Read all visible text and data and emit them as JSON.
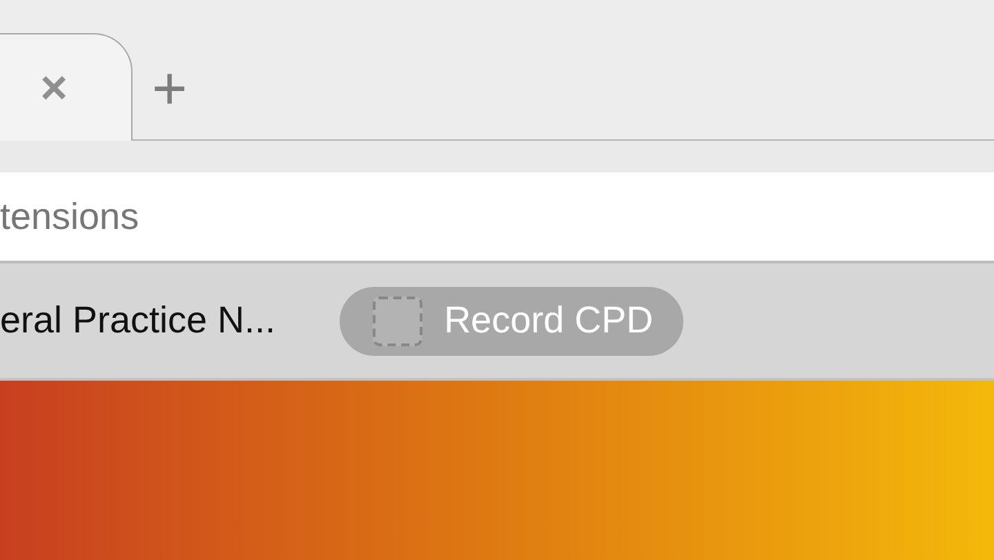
{
  "tabs": [
    {
      "selected": true,
      "close": "×"
    }
  ],
  "new_tab": {
    "label": "+"
  },
  "address_bar": {
    "value": "tensions"
  },
  "bookmarks": [
    {
      "label": "eral Practice N...",
      "selected": false,
      "icon": false
    },
    {
      "label": "Record CPD",
      "selected": true,
      "icon": true
    }
  ]
}
